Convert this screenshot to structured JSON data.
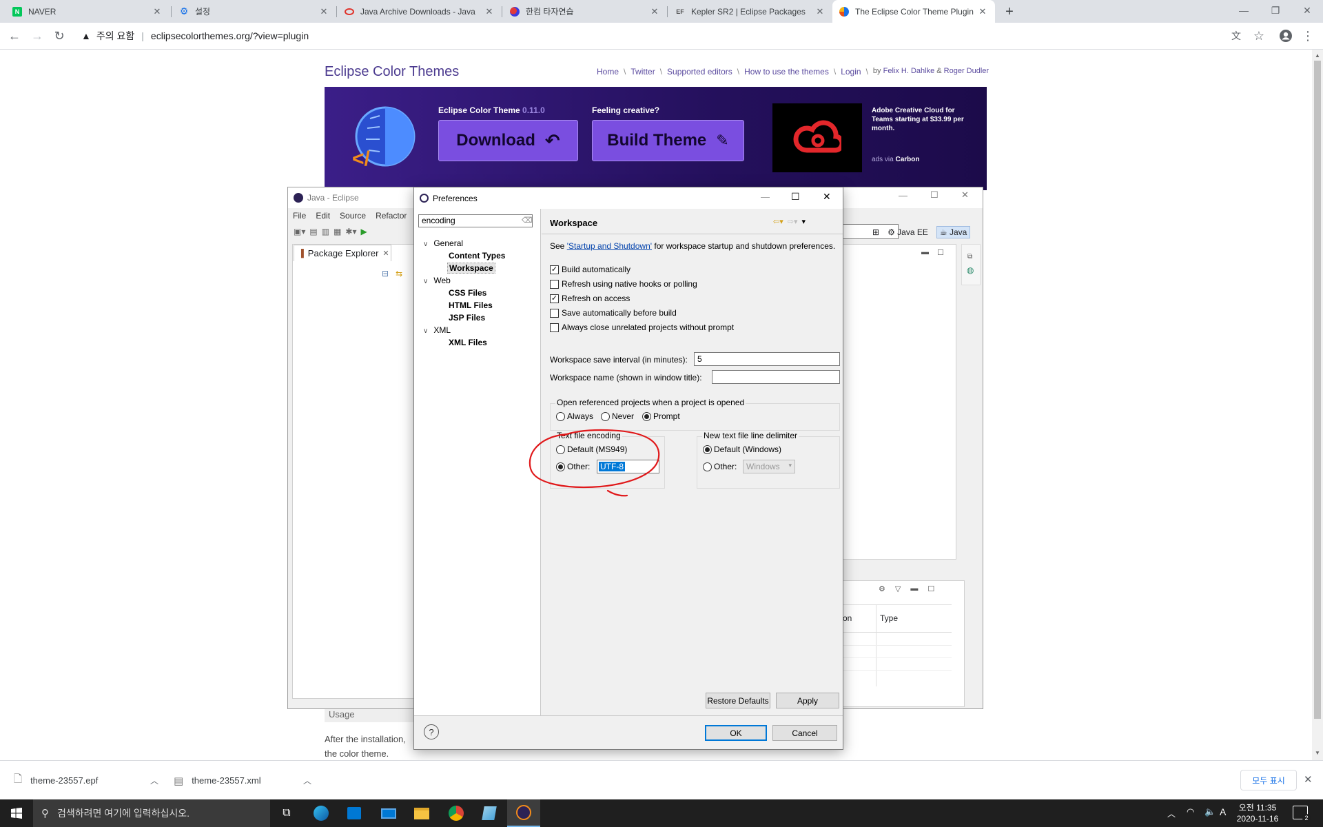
{
  "browser": {
    "tabs": [
      {
        "title": "NAVER",
        "fav_text": "N",
        "fav_color": "#03c75a"
      },
      {
        "title": "설정",
        "fav_text": "⚙",
        "fav_color": "#1a73e8"
      },
      {
        "title": "Java Archive Downloads - Java",
        "fav_text": "",
        "fav_color": "#e0332b"
      },
      {
        "title": "한컴 타자연습",
        "fav_text": "",
        "fav_color": "#6a2c91"
      },
      {
        "title": "Kepler SR2 | Eclipse Packages",
        "fav_text": "EF",
        "fav_color": "#555555"
      },
      {
        "title": "The Eclipse Color Theme Plugin",
        "fav_text": "",
        "fav_color": "#1a73e8"
      }
    ],
    "new_tab": "+",
    "security_label": "주의 요함",
    "url": "eclipsecolorthemes.org/?view=plugin"
  },
  "site": {
    "title": "Eclipse Color Themes",
    "nav": [
      "Home",
      "Twitter",
      "Supported editors",
      "How to use the themes",
      "Login"
    ],
    "byline_prefix": "by",
    "author1": "Felix H. Dahlke",
    "amp": "&",
    "author2": "Roger Dudler",
    "banner": {
      "plugin_name": "Eclipse Color Theme",
      "version": "0.11.0",
      "download": "Download",
      "creative": "Feeling creative?",
      "build": "Build Theme",
      "ad_text": "Adobe Creative Cloud for Teams starting at $33.99 per month.",
      "ads_via": "ads via",
      "ads_brand": "Carbon"
    },
    "usage_heading": "Usage",
    "usage_text1": "After the installation,",
    "usage_text2": "the color theme."
  },
  "eclipse": {
    "title": "Java - Eclipse",
    "menu": [
      "File",
      "Edit",
      "Source",
      "Refactor"
    ],
    "package_explorer": "Package Explorer",
    "perspectives": [
      "Java EE",
      "Java"
    ],
    "table_cols": [
      "on",
      "Type"
    ]
  },
  "prefs": {
    "title": "Preferences",
    "filter": "encoding",
    "tree": [
      {
        "label": "General",
        "level": 0,
        "expanded": true
      },
      {
        "label": "Content Types",
        "level": 1
      },
      {
        "label": "Workspace",
        "level": 1,
        "selected": true
      },
      {
        "label": "Web",
        "level": 0,
        "expanded": true
      },
      {
        "label": "CSS Files",
        "level": 1
      },
      {
        "label": "HTML Files",
        "level": 1
      },
      {
        "label": "JSP Files",
        "level": 1
      },
      {
        "label": "XML",
        "level": 0,
        "expanded": true
      },
      {
        "label": "XML Files",
        "level": 1
      }
    ],
    "page_title": "Workspace",
    "see_prefix": "See",
    "see_link": "'Startup and Shutdown'",
    "see_suffix": "for workspace startup and shutdown preferences.",
    "checks": [
      {
        "label": "Build automatically",
        "checked": true
      },
      {
        "label": "Refresh using native hooks or polling",
        "checked": false
      },
      {
        "label": "Refresh on access",
        "checked": true
      },
      {
        "label": "Save automatically before build",
        "checked": false
      },
      {
        "label": "Always close unrelated projects without prompt",
        "checked": false
      }
    ],
    "save_interval_label": "Workspace save interval (in minutes):",
    "save_interval_value": "5",
    "ws_name_label": "Workspace name (shown in window title):",
    "ws_name_value": "",
    "open_ref_label": "Open referenced projects when a project is opened",
    "open_ref_options": [
      "Always",
      "Never",
      "Prompt"
    ],
    "open_ref_selected": "Prompt",
    "encoding_group": "Text file encoding",
    "encoding_default": "Default (MS949)",
    "encoding_other": "Other:",
    "encoding_value": "UTF-8",
    "delim_group": "New text file line delimiter",
    "delim_default": "Default (Windows)",
    "delim_other": "Other:",
    "delim_value": "Windows",
    "restore_defaults": "Restore Defaults",
    "apply": "Apply",
    "ok": "OK",
    "cancel": "Cancel",
    "help": "?"
  },
  "shelf": {
    "files": [
      "theme-23557.epf",
      "theme-23557.xml"
    ],
    "show_all": "모두 표시"
  },
  "taskbar": {
    "search_placeholder": "검색하려면 여기에 입력하십시오.",
    "ime": "A",
    "time": "오전 11:35",
    "date": "2020-11-16",
    "notif_count": "2"
  },
  "colors": {
    "annotation": "#e0191b",
    "selection": "#0078d7",
    "site_purple": "#4b3a8f"
  }
}
